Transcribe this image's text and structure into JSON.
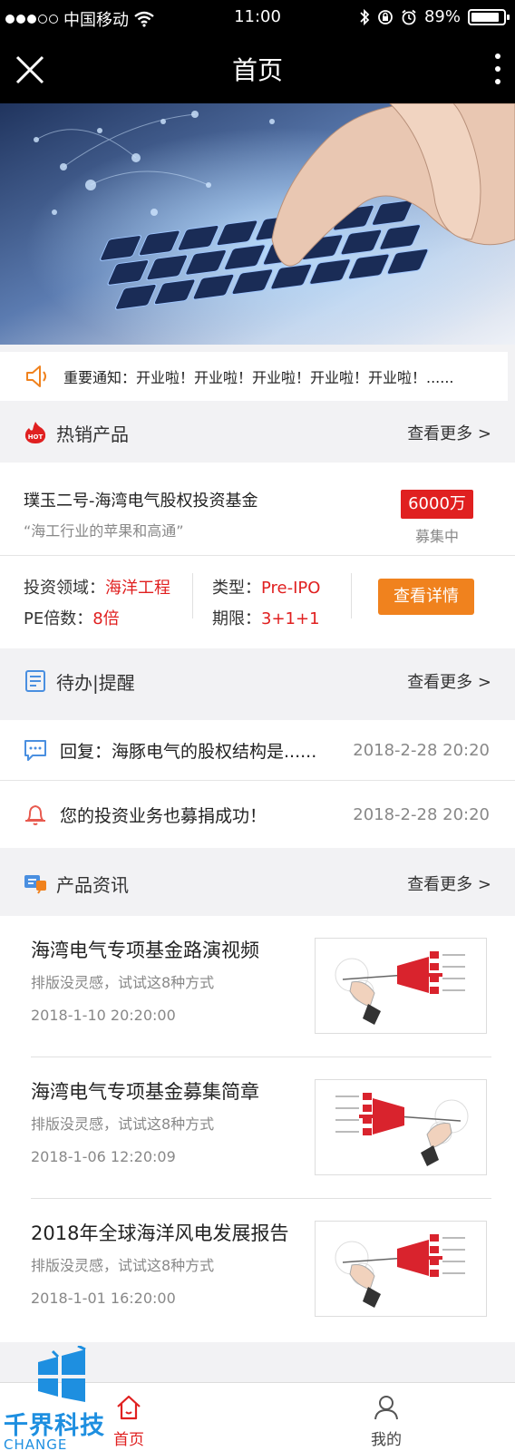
{
  "status_bar": {
    "carrier": "中国移动",
    "time": "11:00",
    "battery": "89%",
    "battery_level": 0.89
  },
  "nav": {
    "title": "首页"
  },
  "notice": {
    "text": "重要通知：开业啦！开业啦！开业啦！开业啦！开业啦！......"
  },
  "hot_products": {
    "label": "热销产品",
    "more": "查看更多 >",
    "hot_badge": "HOT",
    "product": {
      "name": "璞玉二号-海湾电气股权投资基金",
      "slogan": "“海工行业的苹果和高通”",
      "amount": "6000万",
      "amount_status": "募集中",
      "field_label": "投资领域：",
      "field_value": "海洋工程",
      "pe_label": "PE倍数：",
      "pe_value": "8倍",
      "type_label": "类型：",
      "type_value": "Pre-IPO",
      "term_label": "期限：",
      "term_value": "3+1+1",
      "detail_button": "查看详情"
    }
  },
  "todo": {
    "label": "待办|提醒",
    "more": "查看更多 >",
    "items": [
      {
        "text": "回复：海豚电气的股权结构是......",
        "date": "2018-2-28 20:20"
      },
      {
        "text": "您的投资业务也募捐成功！",
        "date": "2018-2-28 20:20"
      }
    ]
  },
  "news": {
    "label": "产品资讯",
    "more": "查看更多 >",
    "items": [
      {
        "title": "海湾电气专项基金路演视频",
        "sub": "排版没灵感，试试这8种方式",
        "date": "2018-1-10 20:20:00"
      },
      {
        "title": "海湾电气专项基金募集简章",
        "sub": "排版没灵感，试试这8种方式",
        "date": "2018-1-06 12:20:09"
      },
      {
        "title": "2018年全球海洋风电发展报告",
        "sub": "排版没灵感，试试这8种方式",
        "date": "2018-1-01 16:20:00"
      }
    ]
  },
  "tabbar": {
    "home": "首页",
    "mine": "我的"
  },
  "watermark": {
    "text": "千界科技",
    "sub": "CHANGE"
  },
  "colors": {
    "accent_red": "#e02020",
    "button_orange": "#f0821e",
    "watermark_blue": "#1e8fe0"
  }
}
